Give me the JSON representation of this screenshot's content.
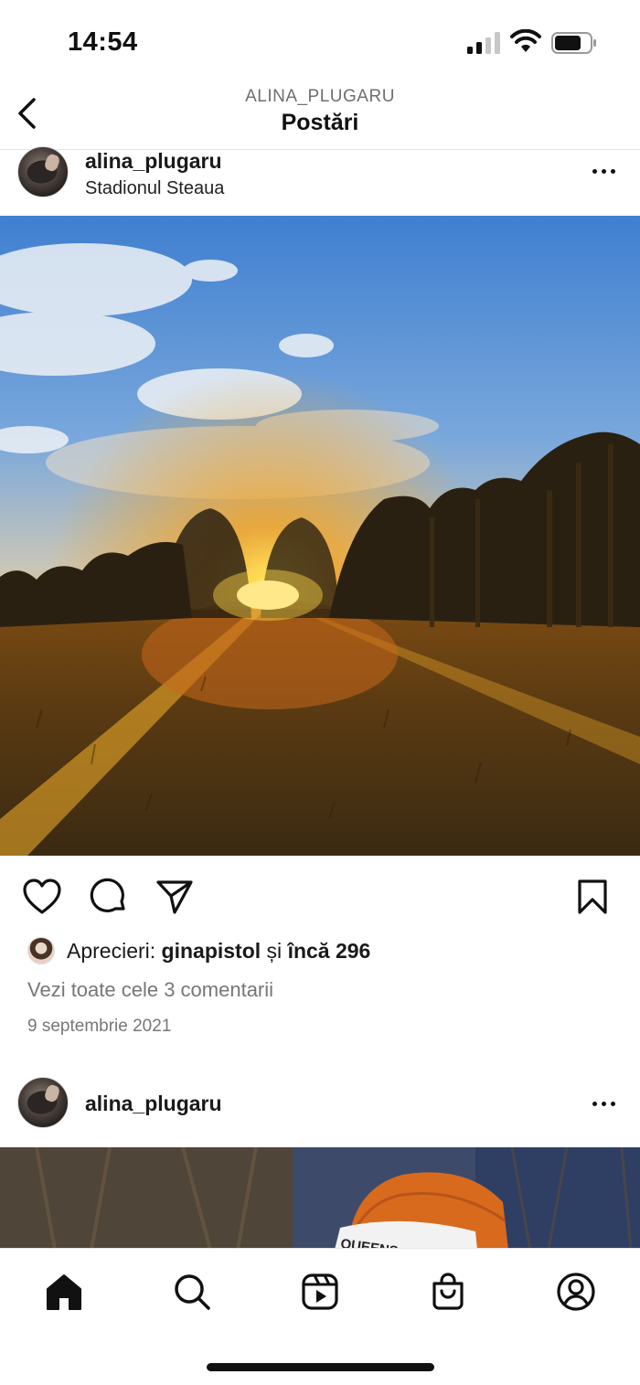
{
  "status_bar": {
    "time": "14:54"
  },
  "header": {
    "subtitle": "ALINA_PLUGARU",
    "title": "Postări"
  },
  "posts": [
    {
      "username": "alina_plugaru",
      "location": "Stadionul Steaua",
      "image_icon": "sunset-photo",
      "likes_prefix": "Aprecieri: ",
      "liked_by": "ginapistol",
      "likes_mid": " și ",
      "likes_rest": "încă 296",
      "comments_link": "Vezi toate cele 3 comentarii",
      "date": "9 septembrie 2021"
    },
    {
      "username": "alina_plugaru",
      "image_icon": "orange-cap-photo",
      "cap_text": "QUEENS"
    }
  ],
  "post_actions": [
    "heart-icon",
    "comment-icon",
    "share-icon",
    "bookmark-icon"
  ],
  "tab_bar": [
    "home-icon",
    "search-icon",
    "reels-icon",
    "shop-icon",
    "profile-icon"
  ]
}
